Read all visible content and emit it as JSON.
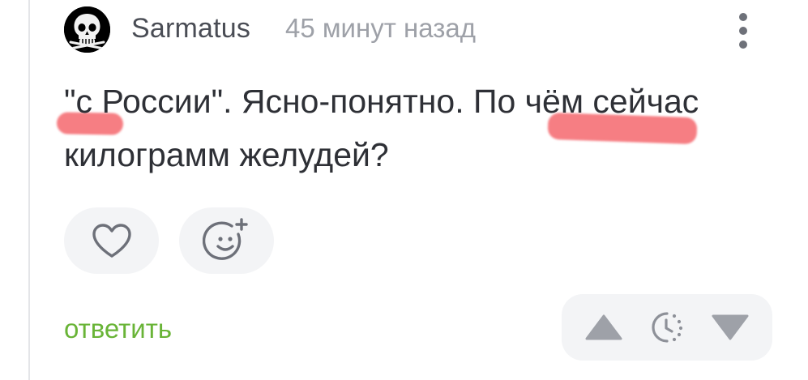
{
  "comment": {
    "author": "Sarmatus",
    "time_ago": "45 минут назад",
    "text_part1": "\"с России\". Ясно-понятно. ",
    "text_highlight": "По чём",
    "text_part2": " сейчас килограмм желудей?"
  },
  "actions": {
    "like_icon": "heart-outline-icon",
    "reaction_icon": "smiley-add-icon",
    "reply_label": "ответить"
  },
  "voting": {
    "upvote_icon": "triangle-up-icon",
    "rating_icon": "clock-dotted-icon",
    "downvote_icon": "triangle-down-icon"
  },
  "colors": {
    "reply_link": "#69b437",
    "username": "#4a4d55",
    "timestamp": "#9ea1a8",
    "highlight": "#f45a60",
    "button_bg": "#f3f4f6"
  }
}
